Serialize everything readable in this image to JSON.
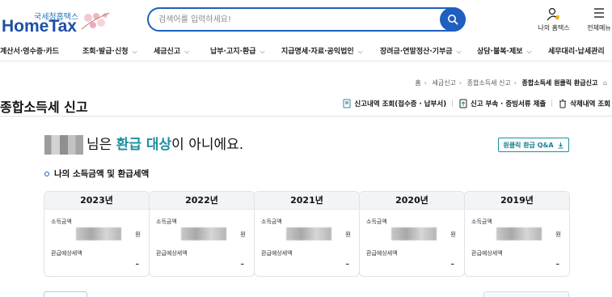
{
  "header": {
    "logo_small": "국세청홈택스",
    "logo_big": "HomeTax",
    "search_placeholder": "검색어를 입력하세요!",
    "my_hometax_label": "나의 홈택스",
    "menu_label": "전체메뉴"
  },
  "nav": {
    "items": [
      "계산서·영수증·카드",
      "조회·발급·신청",
      "세금신고",
      "납부·고지·환급",
      "지급명세·자료·공익법인",
      "장려금·연말정산·기부금",
      "상담·불복·제보",
      "세무대리·납세관리"
    ]
  },
  "breadcrumb": [
    "홈",
    "세금신고",
    "종합소득세 신고",
    "종합소득세 원클릭 환급신고"
  ],
  "page": {
    "title": "종합소득세 신고",
    "actions": [
      "신고내역 조회(접수증 · 납부서)",
      "신고 부속 · 증빙서류 제출",
      "삭제내역 조회"
    ]
  },
  "message": {
    "suffix_pre": "님은 ",
    "highlight": "환급 대상",
    "suffix_post": "이 아니에요."
  },
  "qa_button": "원클릭 환급 Q&A",
  "section_title": "나의 소득금액 및 환급세액",
  "years": [
    {
      "year": "2023년",
      "income_label": "소득금액",
      "unit": "원",
      "refund_label": "환급예상세액",
      "refund_value": "–"
    },
    {
      "year": "2022년",
      "income_label": "소득금액",
      "unit": "원",
      "refund_label": "환급예상세액",
      "refund_value": "–"
    },
    {
      "year": "2021년",
      "income_label": "소득금액",
      "unit": "원",
      "refund_label": "환급예상세액",
      "refund_value": "–"
    },
    {
      "year": "2020년",
      "income_label": "소득금액",
      "unit": "원",
      "refund_label": "환급예상세액",
      "refund_value": "–"
    },
    {
      "year": "2019년",
      "income_label": "소득금액",
      "unit": "원",
      "refund_label": "환급예상세액",
      "refund_value": "–"
    }
  ],
  "colors": {
    "brand_blue": "#1f5fbf",
    "accent_teal": "#1a8fa0"
  }
}
